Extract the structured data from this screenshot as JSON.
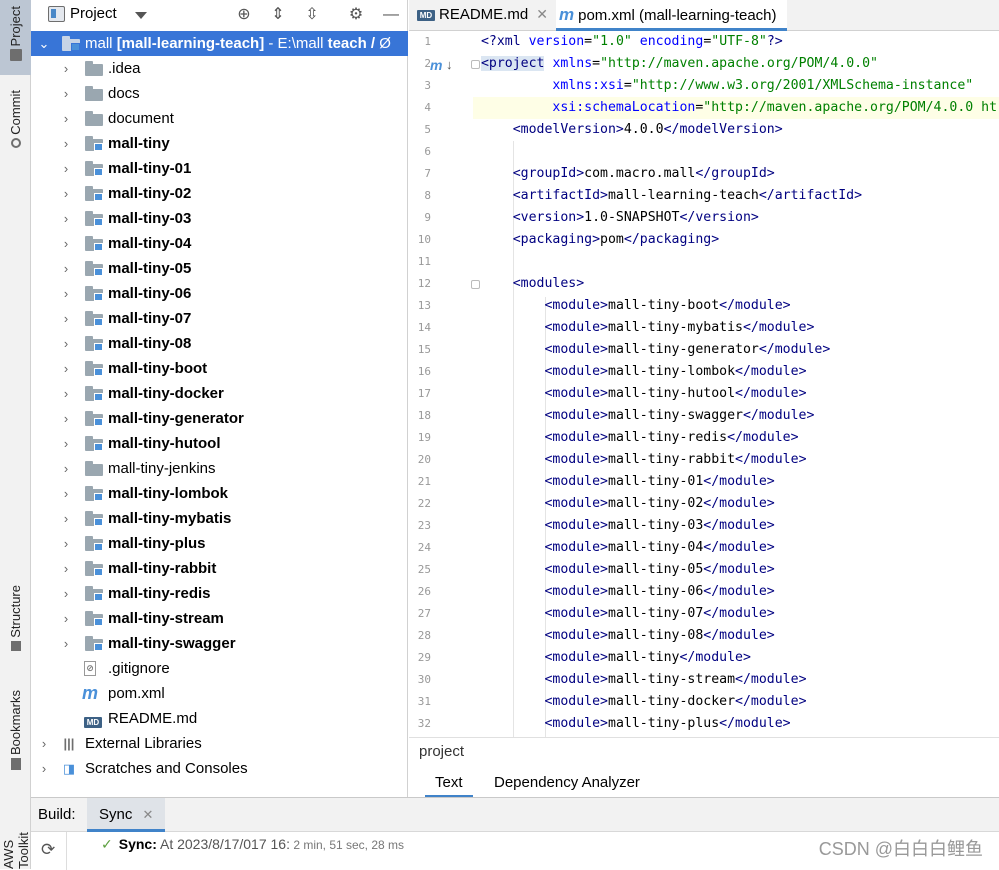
{
  "strip": {
    "project": "Project",
    "commit": "Commit",
    "structure": "Structure",
    "bookmarks": "Bookmarks",
    "aws": "AWS Toolkit"
  },
  "project_panel": {
    "title": "Project",
    "root": {
      "name": "mall",
      "module": "[mall-learning-teach]",
      "path_prefix": " - E:\\mall ",
      "path_bold": "teach / ",
      "path_suffix": "Ø"
    },
    "folders": [
      {
        "label": ".idea",
        "bold": false,
        "module": false
      },
      {
        "label": "docs",
        "bold": false,
        "module": false
      },
      {
        "label": "document",
        "bold": false,
        "module": false
      },
      {
        "label": "mall-tiny",
        "bold": true,
        "module": true
      },
      {
        "label": "mall-tiny-01",
        "bold": true,
        "module": true
      },
      {
        "label": "mall-tiny-02",
        "bold": true,
        "module": true
      },
      {
        "label": "mall-tiny-03",
        "bold": true,
        "module": true
      },
      {
        "label": "mall-tiny-04",
        "bold": true,
        "module": true
      },
      {
        "label": "mall-tiny-05",
        "bold": true,
        "module": true
      },
      {
        "label": "mall-tiny-06",
        "bold": true,
        "module": true
      },
      {
        "label": "mall-tiny-07",
        "bold": true,
        "module": true
      },
      {
        "label": "mall-tiny-08",
        "bold": true,
        "module": true
      },
      {
        "label": "mall-tiny-boot",
        "bold": true,
        "module": true
      },
      {
        "label": "mall-tiny-docker",
        "bold": true,
        "module": true
      },
      {
        "label": "mall-tiny-generator",
        "bold": true,
        "module": true
      },
      {
        "label": "mall-tiny-hutool",
        "bold": true,
        "module": true
      },
      {
        "label": "mall-tiny-jenkins",
        "bold": false,
        "module": false
      },
      {
        "label": "mall-tiny-lombok",
        "bold": true,
        "module": true
      },
      {
        "label": "mall-tiny-mybatis",
        "bold": true,
        "module": true
      },
      {
        "label": "mall-tiny-plus",
        "bold": true,
        "module": true
      },
      {
        "label": "mall-tiny-rabbit",
        "bold": true,
        "module": true
      },
      {
        "label": "mall-tiny-redis",
        "bold": true,
        "module": true
      },
      {
        "label": "mall-tiny-stream",
        "bold": true,
        "module": true
      },
      {
        "label": "mall-tiny-swagger",
        "bold": true,
        "module": true
      }
    ],
    "files": [
      {
        "label": ".gitignore",
        "icon": "gitignore-icon"
      },
      {
        "label": "pom.xml",
        "icon": "maven-icon"
      },
      {
        "label": "README.md",
        "icon": "markdown-icon"
      }
    ],
    "external_libraries": "External Libraries",
    "scratches": "Scratches and Consoles"
  },
  "editor": {
    "tabs": [
      {
        "label": "README.md",
        "icon": "markdown-icon",
        "active": false
      },
      {
        "label": "pom.xml (mall-learning-teach)",
        "icon": "maven-icon",
        "active": true
      }
    ],
    "line_numbers": [
      "1",
      "2",
      "3",
      "4",
      "5",
      "6",
      "7",
      "8",
      "9",
      "10",
      "11",
      "12",
      "13",
      "14",
      "15",
      "16",
      "17",
      "18",
      "19",
      "20",
      "21",
      "22",
      "23",
      "24",
      "25",
      "26",
      "27",
      "28",
      "29",
      "30",
      "31",
      "32"
    ],
    "modules": [
      "mall-tiny-boot",
      "mall-tiny-mybatis",
      "mall-tiny-generator",
      "mall-tiny-lombok",
      "mall-tiny-hutool",
      "mall-tiny-swagger",
      "mall-tiny-redis",
      "mall-tiny-rabbit",
      "mall-tiny-01",
      "mall-tiny-02",
      "mall-tiny-03",
      "mall-tiny-04",
      "mall-tiny-05",
      "mall-tiny-06",
      "mall-tiny-07",
      "mall-tiny-08",
      "mall-tiny",
      "mall-tiny-stream",
      "mall-tiny-docker",
      "mall-tiny-plus"
    ],
    "xml_decl": "<?xml version=\"1.0\" encoding=\"UTF-8\"?>",
    "project_xmlns": "http://maven.apache.org/POM/4.0.0",
    "project_xsi": "http://www.w3.org/2001/XMLSchema-instance",
    "project_schema": "http://maven.apache.org/POM/4.0.0 ht",
    "model_version": "4.0.0",
    "group_id": "com.macro.mall",
    "artifact_id": "mall-learning-teach",
    "version": "1.0-SNAPSHOT",
    "packaging": "pom",
    "breadcrumb": "project",
    "bottom_tabs": [
      "Text",
      "Dependency Analyzer"
    ]
  },
  "build": {
    "label": "Build:",
    "tab": "Sync",
    "status_label": "Sync:",
    "status_time": " At 2023/8/17/017 16:",
    "duration": " 2 min, 51 sec, 28 ms"
  },
  "watermark": "CSDN @白白白鲤鱼"
}
